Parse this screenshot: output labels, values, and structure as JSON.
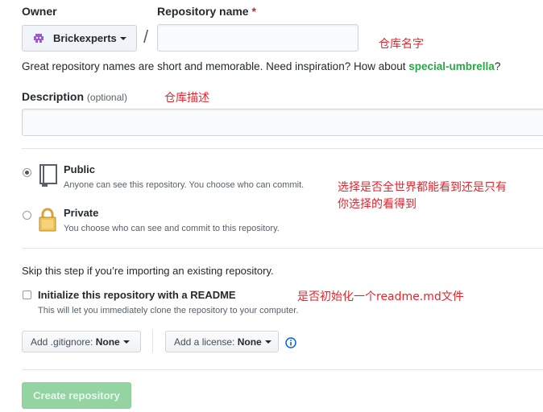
{
  "owner": {
    "label": "Owner",
    "name": "Brickexperts"
  },
  "separator": "/",
  "repository_name": {
    "label": "Repository name",
    "required_mark": "*",
    "value": "",
    "annotation": "仓库名字"
  },
  "name_hint": {
    "prefix": "Great repository names are short and memorable. Need inspiration? How about",
    "suggestion": "special-umbrella",
    "suffix": "?"
  },
  "description": {
    "label": "Description",
    "optional": "(optional)",
    "value": "",
    "annotation": "仓库描述"
  },
  "visibility": {
    "selected": "public",
    "options": [
      {
        "id": "public",
        "title": "Public",
        "detail": "Anyone can see this repository. You choose who can commit."
      },
      {
        "id": "private",
        "title": "Private",
        "detail": "You choose who can see and commit to this repository."
      }
    ],
    "annotation_line1": "选择是否全世界都能看到还是只有",
    "annotation_line2": "你选择的看得到"
  },
  "skip_note": "Skip this step if you’re importing an existing repository.",
  "readme": {
    "label": "Initialize this repository with a README",
    "detail": "This will let you immediately clone the repository to your computer.",
    "checked": false,
    "annotation": "是否初始化一个readme.md文件"
  },
  "gitignore": {
    "label": "Add .gitignore:",
    "value": "None"
  },
  "license": {
    "label": "Add a license:",
    "value": "None"
  },
  "create_button": "Create repository",
  "colors": {
    "annotation": "#e3262d",
    "create_button_bg": "#94d3a2",
    "suggestion": "#28a745",
    "info_icon": "#0366d6"
  }
}
